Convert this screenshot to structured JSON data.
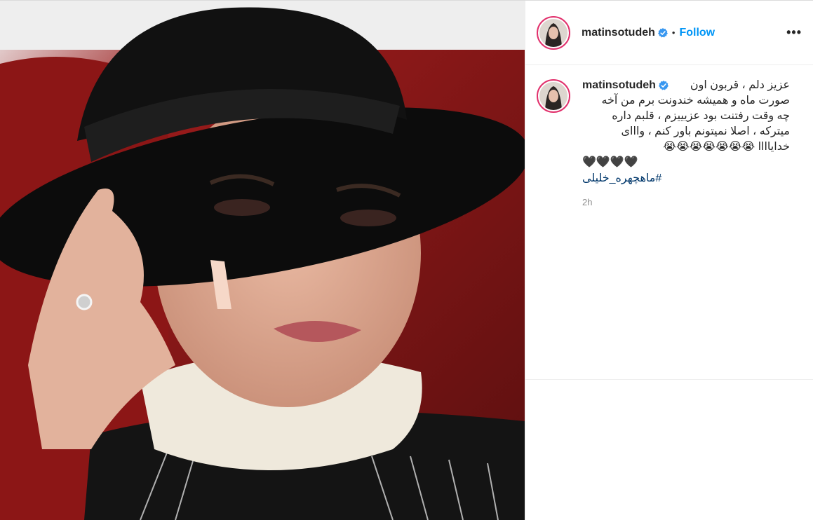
{
  "post": {
    "username": "matinsotudeh",
    "follow_label": "Follow",
    "separator": "•",
    "more_label": "•••",
    "caption": {
      "line1": "عزیز دلم ، قربون اون",
      "line2": "صورت ماه و همیشه خندونت برم من آخه",
      "line3": "چه وقت رفتنت بود عزیییزم ، قلبم داره",
      "line4": "میترکه ، اصلا نمیتونم باور کنم ، وااای",
      "line5": "خدایاااا 😭😭😭😭😭😭😭",
      "line6": "🖤🖤🖤🖤",
      "hashtag": "#ماهچهره_خلیلی"
    },
    "timestamp": "2h"
  },
  "colors": {
    "accent_blue": "#0095f6",
    "hashtag": "#00376b",
    "story_ring": "#e1306c",
    "muted": "#8e8e8e"
  },
  "icons": {
    "verified": "verified-badge-icon",
    "more": "more-options-icon"
  }
}
